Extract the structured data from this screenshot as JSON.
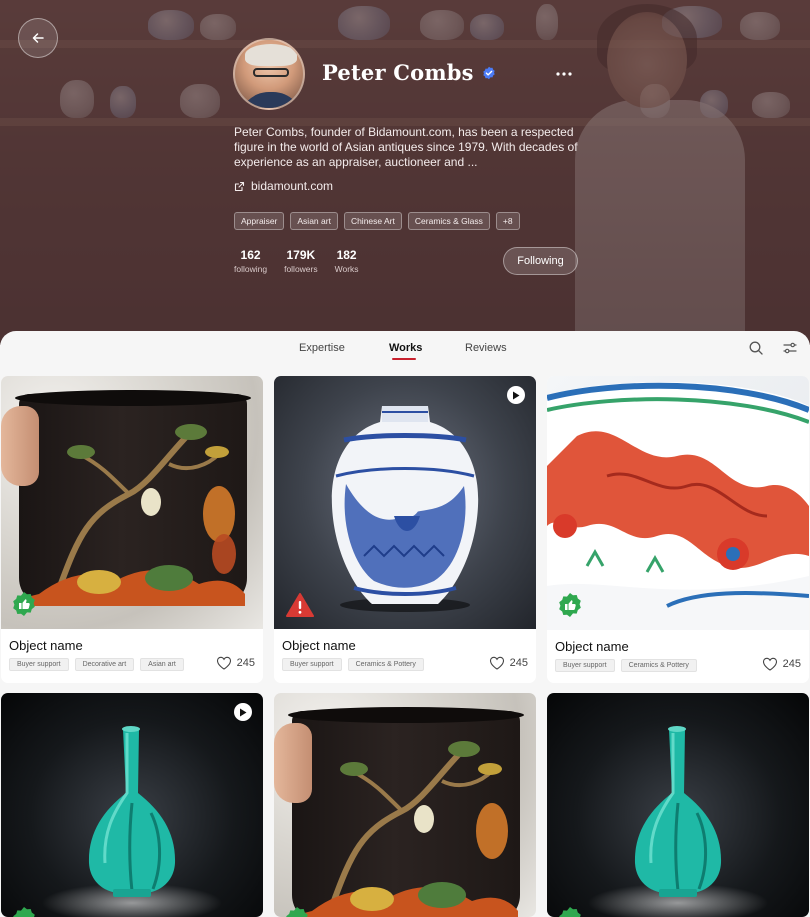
{
  "profile": {
    "name": "Peter Combs",
    "bio": "Peter Combs, founder of Bidamount.com, has been a respected figure in the world of Asian antiques since 1979. With decades of experience as an appraiser, auctioneer and ...",
    "website": "bidamount.com",
    "tags": [
      "Appraiser",
      "Asian art",
      "Chinese Art",
      "Ceramics & Glass",
      "+8"
    ],
    "stats": [
      {
        "value": "162",
        "label": "following"
      },
      {
        "value": "179K",
        "label": "followers"
      },
      {
        "value": "182",
        "label": "Works"
      }
    ],
    "follow_label": "Following"
  },
  "tabs": [
    {
      "label": "Expertise"
    },
    {
      "label": "Works"
    },
    {
      "label": "Reviews"
    }
  ],
  "active_tab": "Works",
  "cards": [
    {
      "name": "Object name",
      "tags": [
        "Buyer support",
        "Decorative art",
        "Asian art"
      ],
      "likes": "245",
      "badge": "thumbs-up",
      "video": false
    },
    {
      "name": "Object name",
      "tags": [
        "Buyer support",
        "Ceramics & Pottery"
      ],
      "likes": "245",
      "badge": "warning",
      "video": true
    },
    {
      "name": "Object name",
      "tags": [
        "Buyer support",
        "Ceramics & Pottery"
      ],
      "likes": "245",
      "badge": "thumbs-up",
      "video": false
    }
  ],
  "colors": {
    "accent": "#c8202d",
    "verified": "#4b7bf5",
    "approved_green": "#2fa84f",
    "warning_red": "#d83a34"
  }
}
